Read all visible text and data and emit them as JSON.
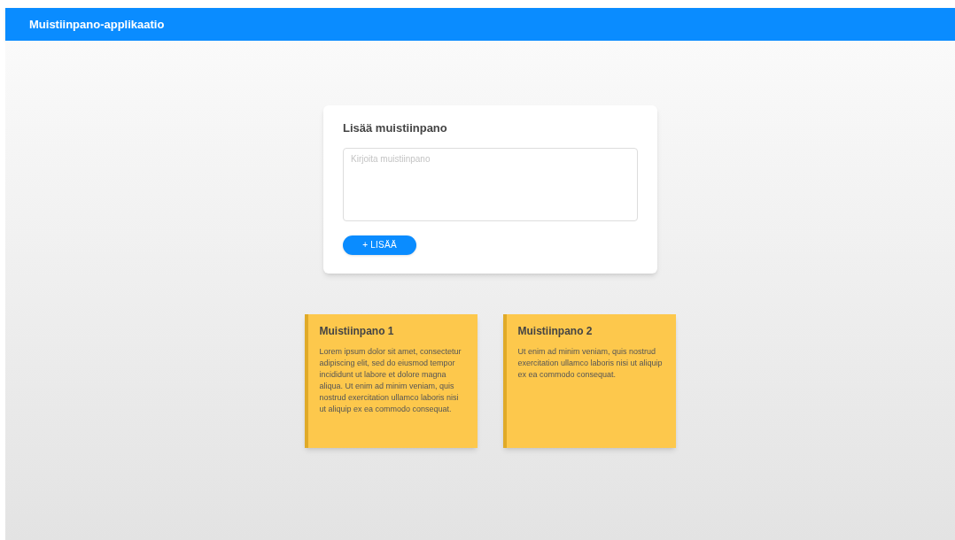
{
  "app_bar": {
    "title": "Muistiinpano-applikaatio"
  },
  "form": {
    "title": "Lisää muistiinpano",
    "placeholder": "Kirjoita muistiinpano",
    "button": "+ LISÄÄ"
  },
  "notes": [
    {
      "title": "Muistiinpano 1",
      "text": "Lorem ipsum dolor sit amet, consectetur adipiscing elit, sed do eiusmod tempor incididunt ut labore et dolore magna aliqua. Ut enim ad minim veniam, quis nostrud exercitation ullamco laboris nisi ut aliquip ex ea commodo consequat."
    },
    {
      "title": "Muistiinpano 2",
      "text": "Ut enim ad minim veniam, quis nostrud exercitation ullamco laboris nisi ut aliquip ex ea commodo consequat."
    }
  ]
}
